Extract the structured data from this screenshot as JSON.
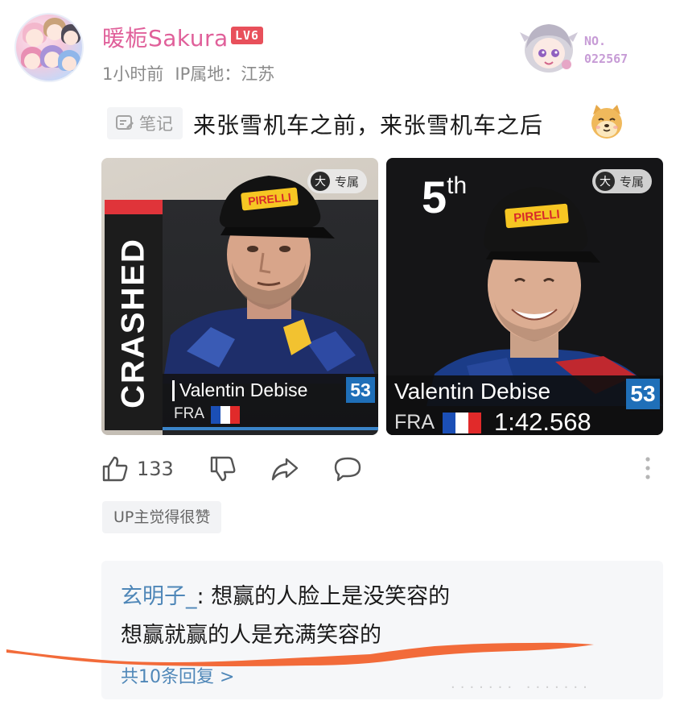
{
  "header": {
    "username": "暖栀Sakura",
    "level": "LV6",
    "time": "1小时前",
    "ip_location": "IP属地：江苏",
    "badge_number": "NO.\n022567"
  },
  "post": {
    "tag_label": "笔记",
    "text": "来张雪机车之前，来张雪机车之后"
  },
  "images": [
    {
      "exclusive_tag": "专属",
      "big_icon": "大",
      "status_text": "CRASHED",
      "rider_name": "Valentin Debise",
      "country": "FRA",
      "number": "53"
    },
    {
      "exclusive_tag": "专属",
      "big_icon": "大",
      "position": "5",
      "position_suffix": "th",
      "rider_name": "Valentin Debise",
      "country": "FRA",
      "number": "53",
      "lap_time": "1:42.568"
    }
  ],
  "actions": {
    "likes": "133"
  },
  "up_badge": "UP主觉得很赞",
  "comment": {
    "user": "玄明子_",
    "separator": ": ",
    "line1": "想赢的人脸上是没笑容的",
    "line2": "想赢就赢的人是充满笑容的",
    "more": "共10条回复 >"
  },
  "colors": {
    "username": "#e0609a",
    "level_bg": "#e8505b",
    "link_blue": "#4f87b8",
    "scribble": "#f26b3a"
  }
}
